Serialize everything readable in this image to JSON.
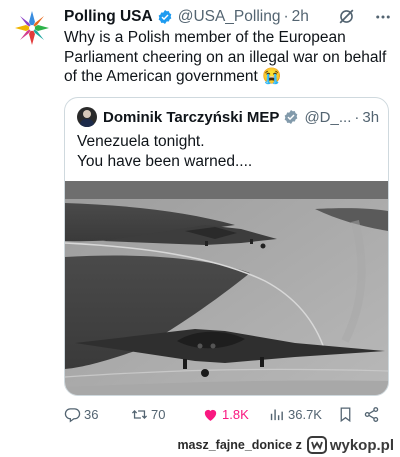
{
  "tweet": {
    "author_name": "Polling USA",
    "handle": "@USA_Polling",
    "separator": "·",
    "time": "2h",
    "text": "Why is a Polish member of the European Parliament cheering on an illegal war on behalf of the American government 😭",
    "avatar_icon": "compass-star-logo-icon",
    "accent_color": "#1d9bf0"
  },
  "quote": {
    "author_name": "Dominik Tarczyński MEP",
    "handle": "@D_...",
    "separator": "·",
    "time": "3h",
    "line1": "Venezuela tonight.",
    "line2": "You have been warned....",
    "media_description_icon": "stealth-bomber-photo"
  },
  "actions": {
    "replies": "36",
    "reposts": "70",
    "likes": "1.8K",
    "views": "36.7K",
    "like_color": "#f91880"
  },
  "footer": {
    "user": "masz_fajne_donice",
    "conjunction": "z",
    "brand": "wykop.pl"
  }
}
